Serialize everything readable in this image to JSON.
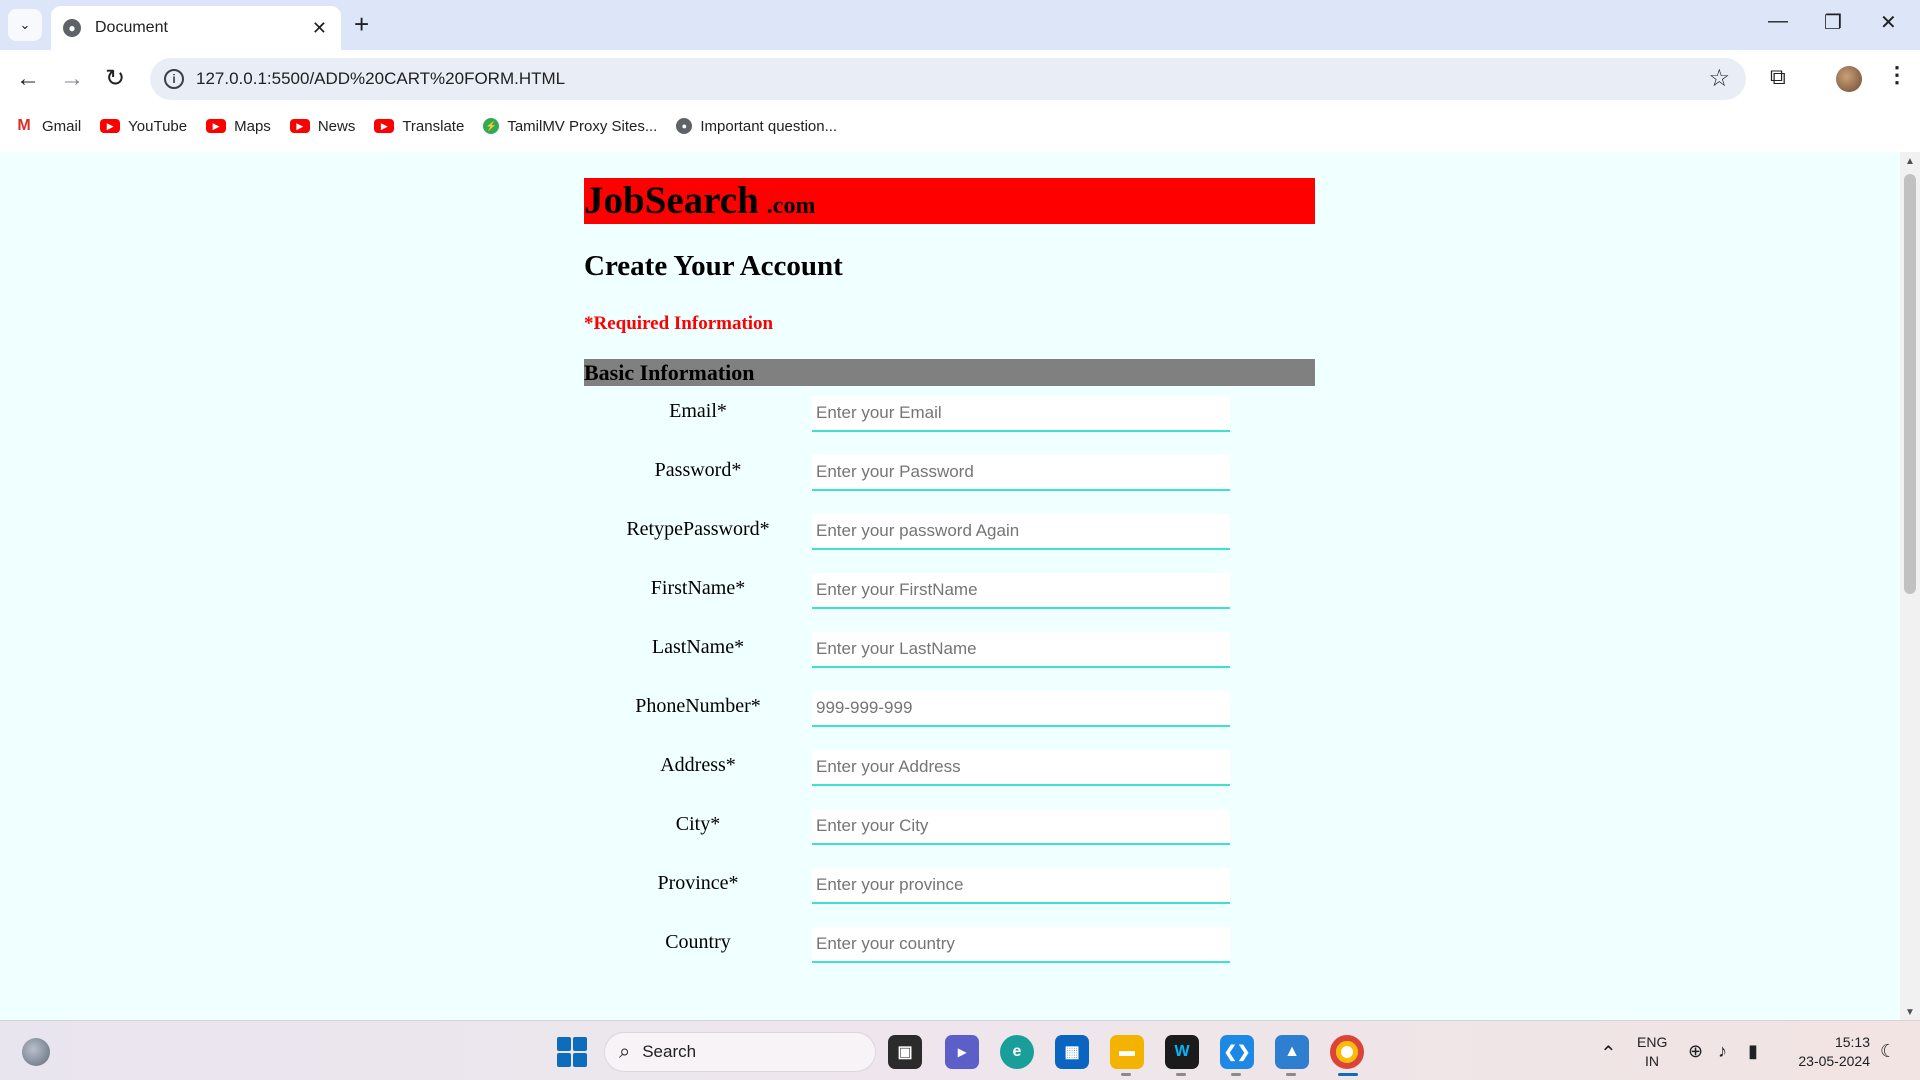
{
  "browser": {
    "tab_title": "Document",
    "url": "127.0.0.1:5500/ADD%20CART%20FORM.HTML",
    "bookmarks": [
      {
        "label": "Gmail",
        "icon": "gmail-icon"
      },
      {
        "label": "YouTube",
        "icon": "youtube-icon"
      },
      {
        "label": "Maps",
        "icon": "youtube-icon"
      },
      {
        "label": "News",
        "icon": "youtube-icon"
      },
      {
        "label": "Translate",
        "icon": "youtube-icon"
      },
      {
        "label": "TamilMV Proxy Sites...",
        "icon": "tamilmv-icon"
      },
      {
        "label": "Important question...",
        "icon": "globe-icon"
      }
    ]
  },
  "page": {
    "brand": "JobSearch",
    "brand_tld": ".com",
    "title": "Create Your Account",
    "required_note": "*Required Information",
    "section_title": "Basic Information",
    "fields": [
      {
        "label": "Email*",
        "placeholder": "Enter your Email"
      },
      {
        "label": "Password*",
        "placeholder": "Enter your Password"
      },
      {
        "label": "RetypePassword*",
        "placeholder": "Enter your password Again"
      },
      {
        "label": "FirstName*",
        "placeholder": "Enter your FirstName"
      },
      {
        "label": "LastName*",
        "placeholder": "Enter your LastName"
      },
      {
        "label": "PhoneNumber*",
        "placeholder": "999-999-999"
      },
      {
        "label": "Address*",
        "placeholder": "Enter your Address"
      },
      {
        "label": "City*",
        "placeholder": "Enter your City"
      },
      {
        "label": "Province*",
        "placeholder": "Enter your province"
      },
      {
        "label": "Country",
        "placeholder": "Enter your country"
      }
    ],
    "colors": {
      "header": "#ff0000",
      "section": "#808080",
      "background": "#f0ffff",
      "input_border": "#40e0d0"
    }
  },
  "taskbar": {
    "search_label": "Search",
    "lang_line1": "ENG",
    "lang_line2": "IN",
    "time": "15:13",
    "date": "23-05-2024"
  }
}
